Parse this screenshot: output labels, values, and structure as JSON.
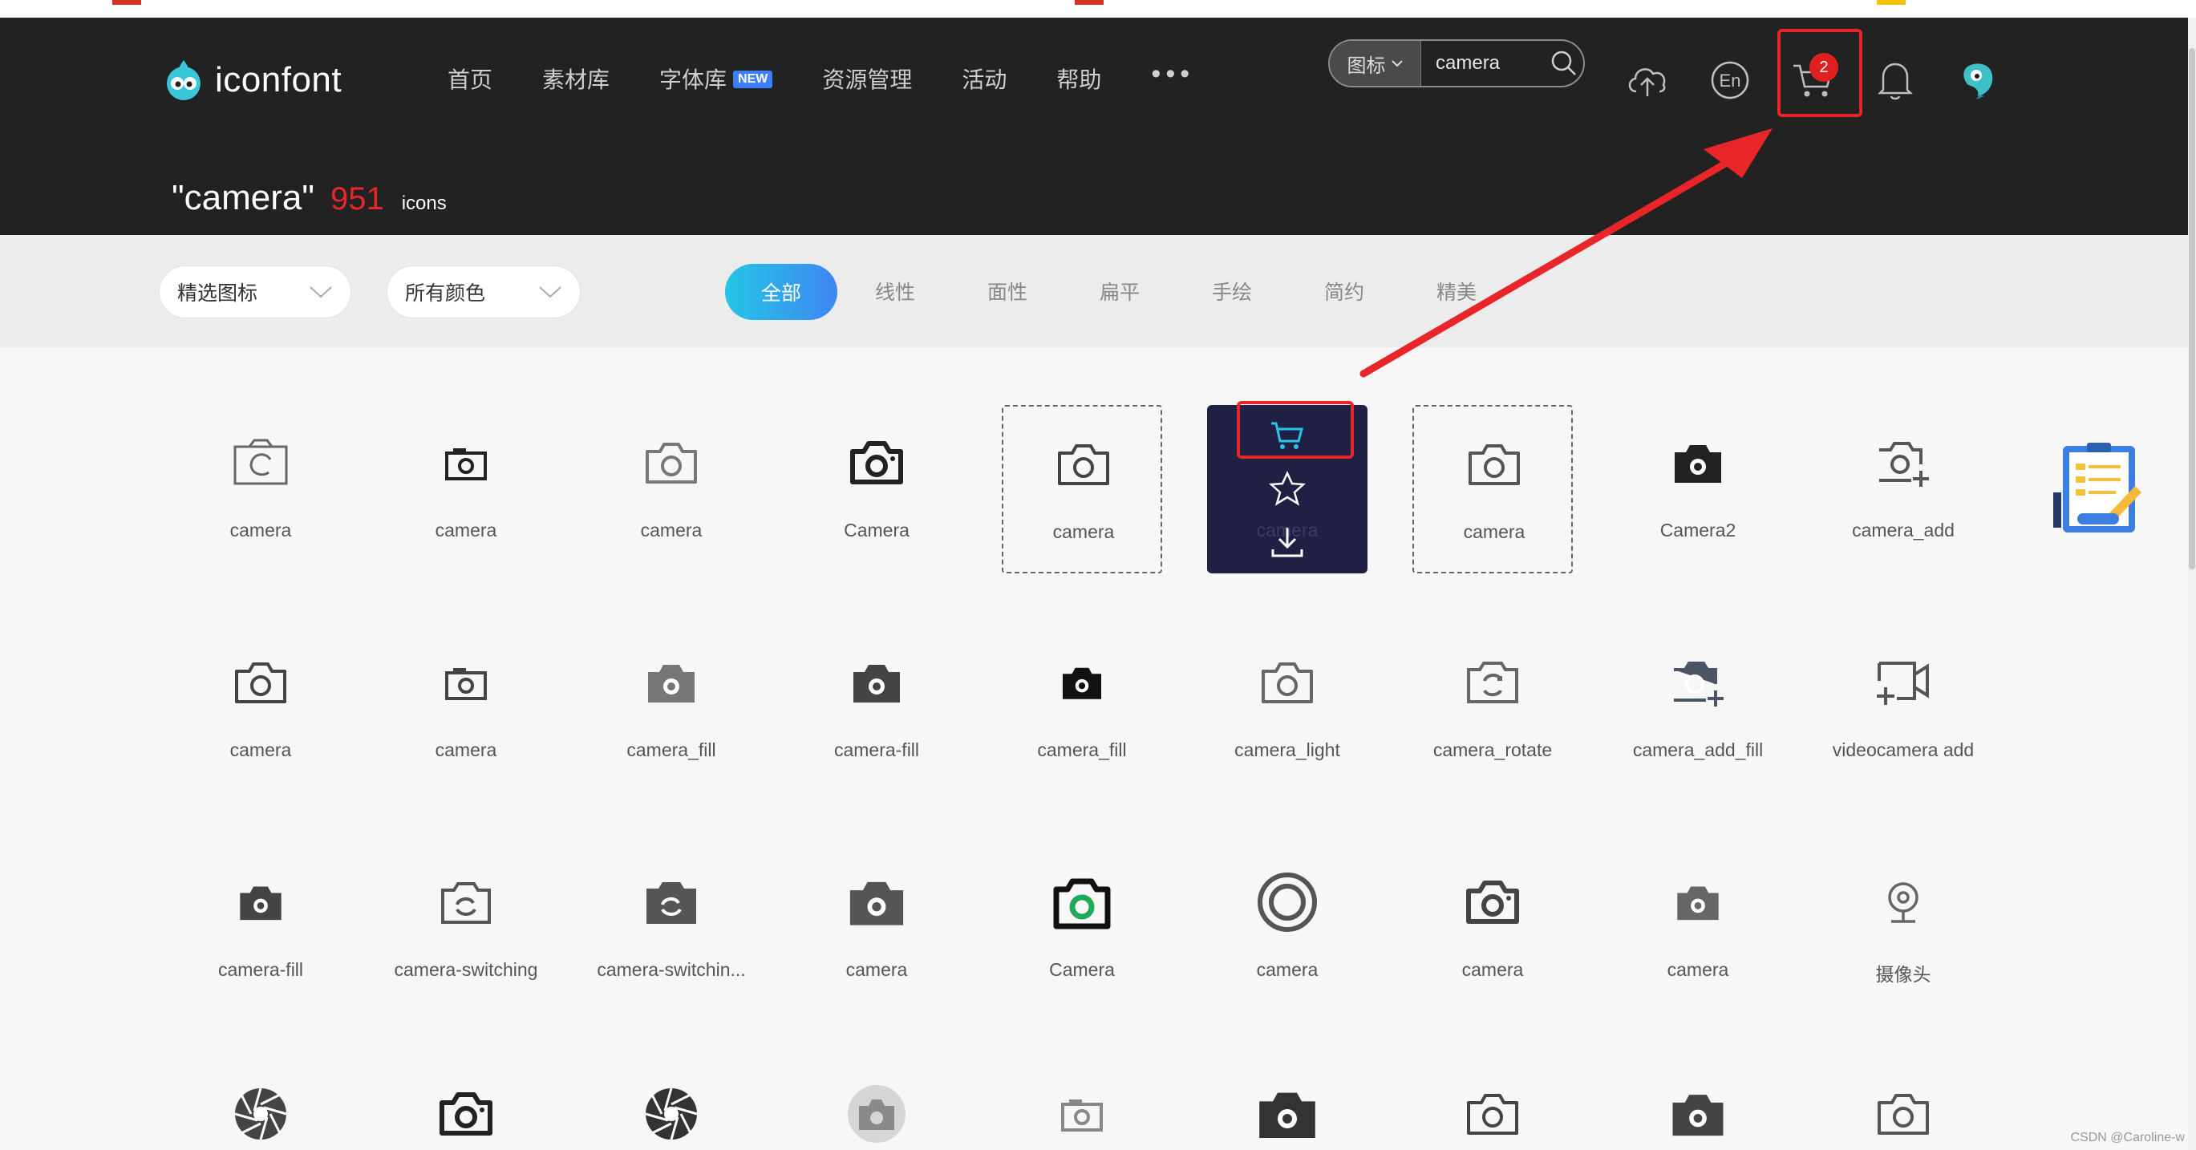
{
  "header": {
    "logo_text": "iconfont",
    "nav": [
      {
        "label": "首页"
      },
      {
        "label": "素材库"
      },
      {
        "label": "字体库",
        "badge": "NEW"
      },
      {
        "label": "资源管理"
      },
      {
        "label": "活动"
      },
      {
        "label": "帮助"
      }
    ],
    "more_label": "•••",
    "search": {
      "type_label": "图标",
      "value": "camera"
    },
    "cart_count": "2",
    "language_icon": "En",
    "icons": [
      "upload-icon",
      "language-icon",
      "cart-icon",
      "bell-icon",
      "avatar"
    ]
  },
  "results": {
    "query": "\"camera\"",
    "count": "951",
    "unit": "icons"
  },
  "filters": {
    "dropdowns": [
      "精选图标",
      "所有颜色"
    ],
    "styles": [
      "全部",
      "线性",
      "面性",
      "扁平",
      "手绘",
      "简约",
      "精美"
    ],
    "active_style": "全部"
  },
  "icons": [
    {
      "label": "camera"
    },
    {
      "label": "camera"
    },
    {
      "label": "camera"
    },
    {
      "label": "Camera"
    },
    {
      "label": "camera"
    },
    {
      "label": "camera"
    },
    {
      "label": "camera"
    },
    {
      "label": "Camera2"
    },
    {
      "label": "camera_add"
    },
    {
      "label": "camera"
    },
    {
      "label": "camera"
    },
    {
      "label": "camera_fill"
    },
    {
      "label": "camera-fill"
    },
    {
      "label": "camera_fill"
    },
    {
      "label": "camera_light"
    },
    {
      "label": "camera_rotate"
    },
    {
      "label": "camera_add_fill"
    },
    {
      "label": "videocamera add"
    },
    {
      "label": "camera-fill"
    },
    {
      "label": "camera-switching"
    },
    {
      "label": "camera-switchin..."
    },
    {
      "label": "camera"
    },
    {
      "label": "Camera"
    },
    {
      "label": "camera"
    },
    {
      "label": "camera"
    },
    {
      "label": "camera"
    },
    {
      "label": "摄像头"
    }
  ],
  "watermark": "CSDN @Caroline-w",
  "colors": {
    "header_bg": "#222222",
    "accent_red": "#e8262a",
    "hover_card": "#1f2044",
    "active_tab_start": "#25c6e5",
    "active_tab_end": "#3e86f3",
    "cart_icon_hover": "#25c6e5"
  }
}
